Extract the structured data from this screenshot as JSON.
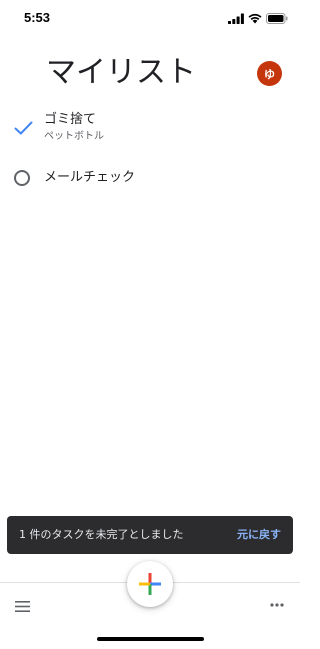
{
  "status_bar": {
    "time": "5:53"
  },
  "header": {
    "title": "マイリスト",
    "avatar_initial": "ゆ",
    "avatar_color": "#c5360d"
  },
  "tasks": [
    {
      "title": "ゴミ捨て",
      "subtitle": "ペットボトル",
      "completed": true,
      "icon": "check-icon"
    },
    {
      "title": "メールチェック",
      "completed": false,
      "icon": "circle-icon"
    }
  ],
  "snackbar": {
    "message": "1 件のタスクを未完了としました",
    "action": "元に戻す",
    "action_color": "#8ab4f8"
  },
  "bottom_bar": {
    "menu_icon": "menu-icon",
    "add_icon": "plus-icon",
    "more_icon": "more-horizontal-icon"
  },
  "colors": {
    "accent_blue": "#4285f4",
    "accent_red": "#ea4335",
    "accent_yellow": "#fbbc05",
    "accent_green": "#34a853"
  }
}
